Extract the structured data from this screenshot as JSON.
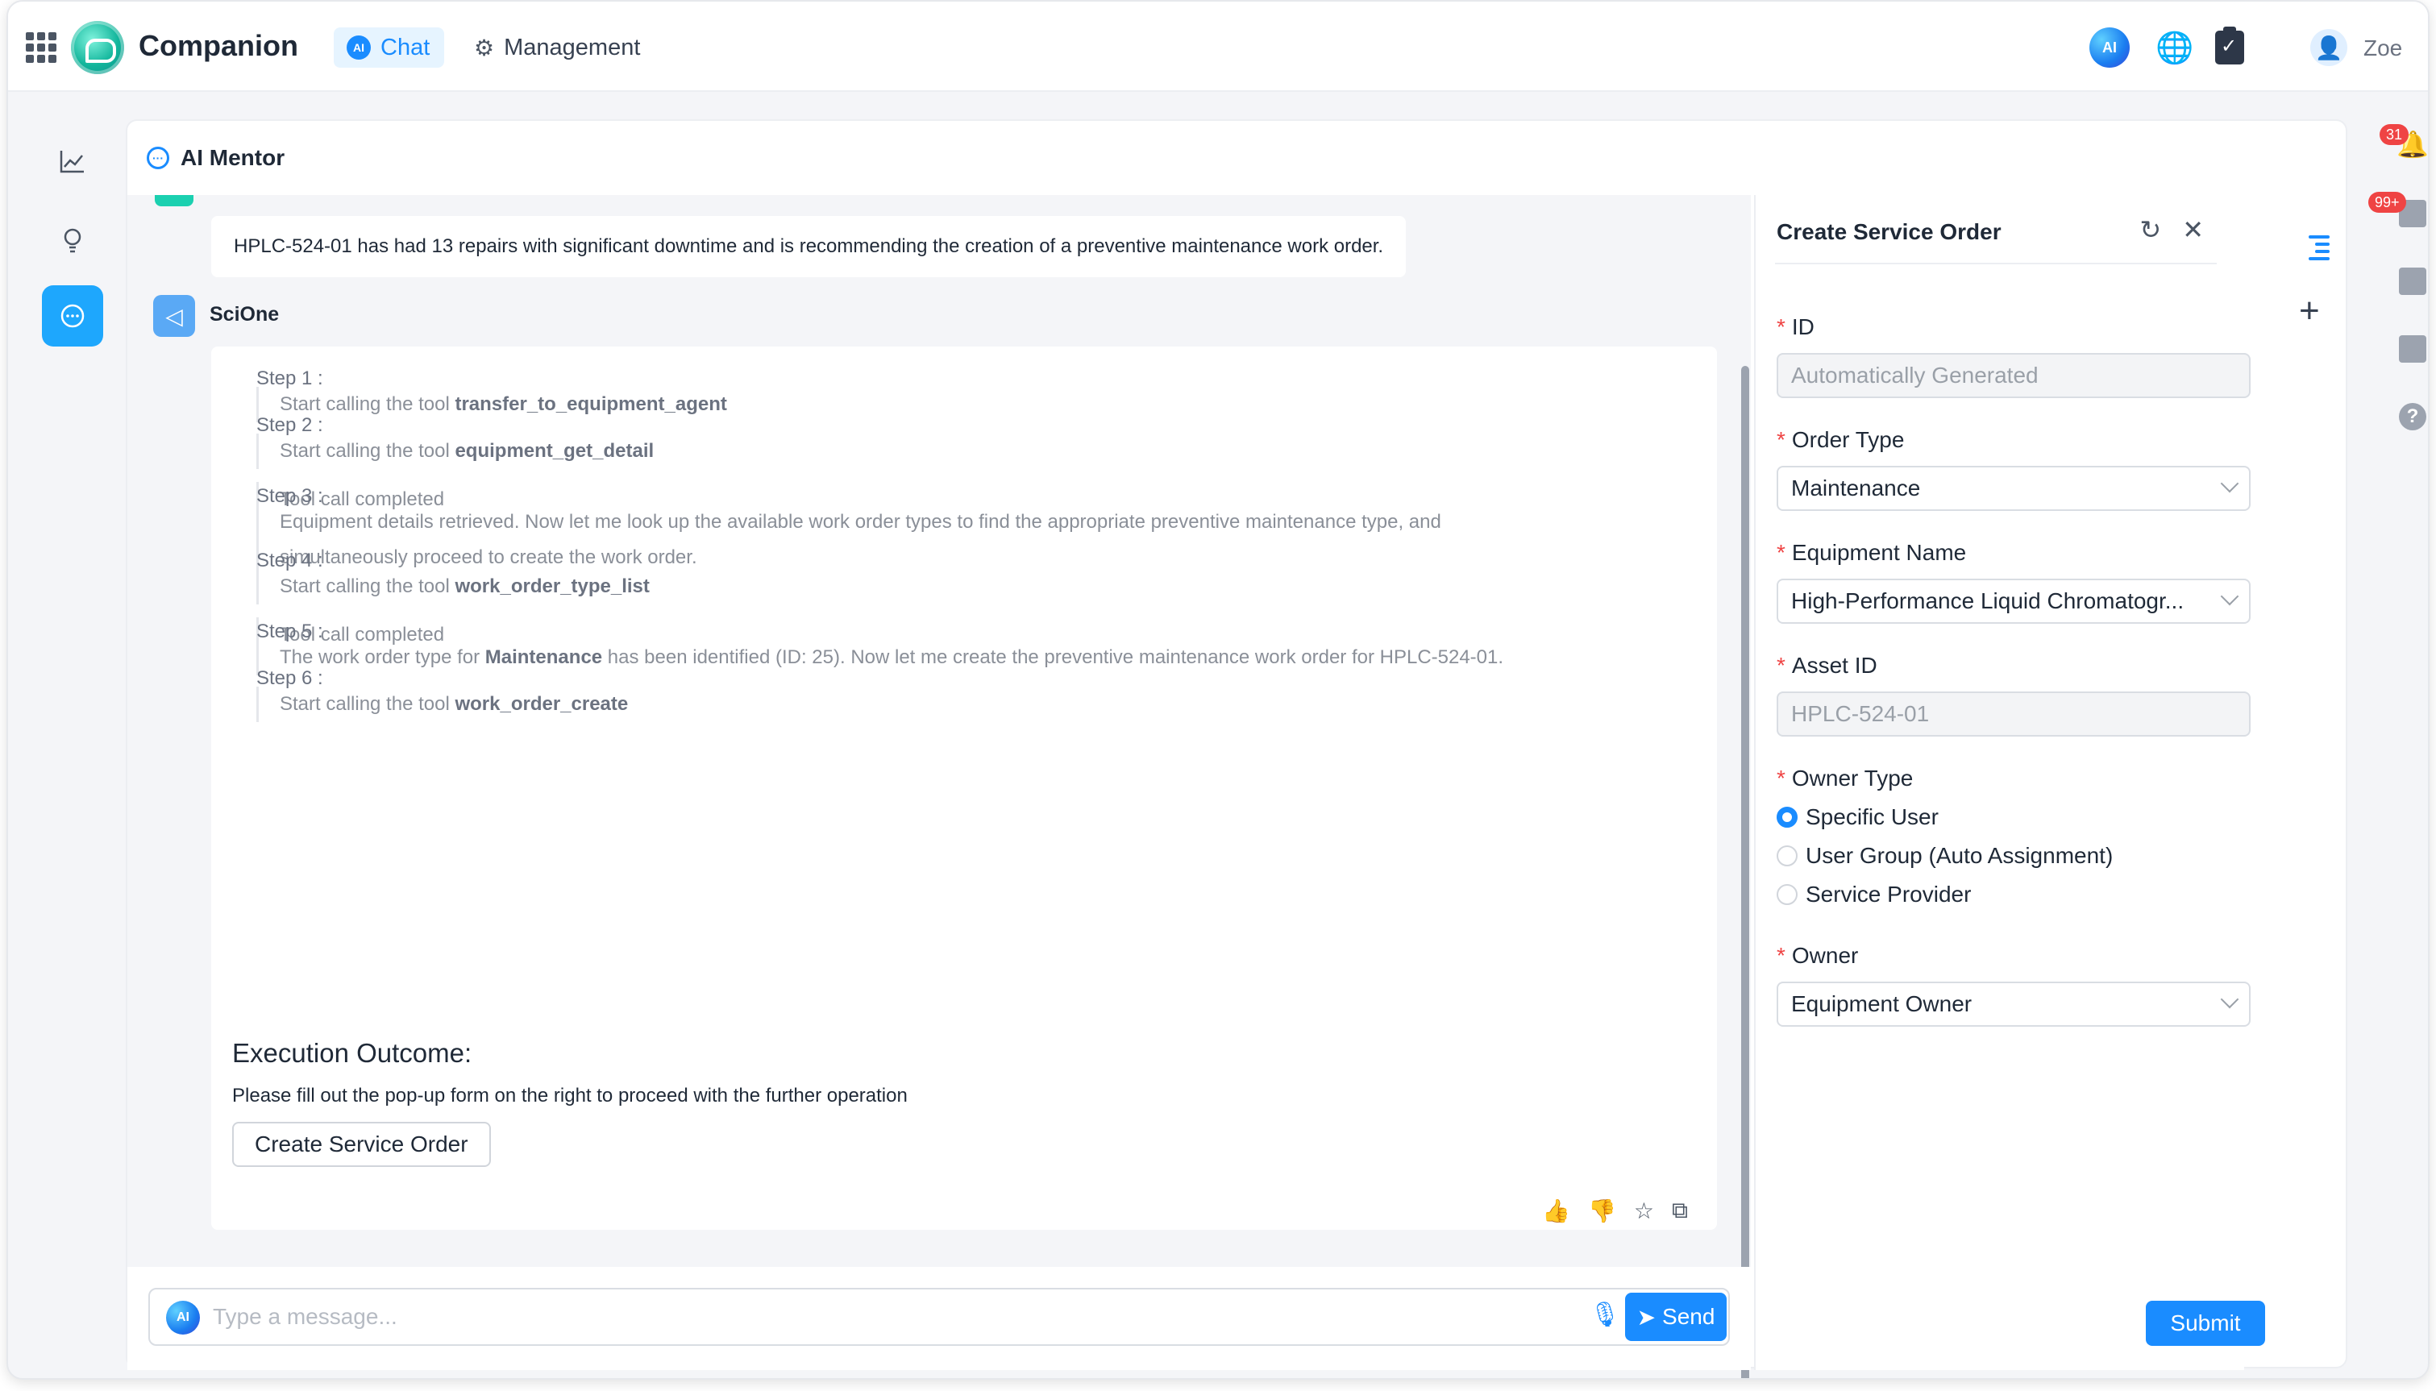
{
  "topbar": {
    "app_name": "Companion",
    "nav": [
      {
        "label": "Chat",
        "badge": "AI"
      },
      {
        "label": "Management"
      }
    ],
    "ai_badge": "AI",
    "user_name": "Zoe"
  },
  "mentor": {
    "title": "AI Mentor"
  },
  "chat": {
    "user_message": "HPLC-524-01 has had 13 repairs with significant downtime and is recommending the creation of a preventive maintenance work order.",
    "assistant_name": "SciOne",
    "steps": [
      {
        "label": "Step 1",
        "lines": [
          {
            "prefix": "Start calling the tool ",
            "bold": "transfer_to_equipment_agent",
            "suffix": ""
          }
        ]
      },
      {
        "label": "Step 2",
        "lines": [
          {
            "prefix": "Start calling the tool ",
            "bold": "equipment_get_detail",
            "suffix": ""
          },
          {
            "prefix": "Tool call completed",
            "bold": "",
            "suffix": ""
          }
        ]
      },
      {
        "label": "Step 3",
        "lines": [
          {
            "prefix": "Equipment details retrieved. Now let me look up the available work order types to find the appropriate preventive maintenance type, and",
            "bold": "",
            "suffix": ""
          },
          {
            "prefix": "simultaneously proceed to create the work order.",
            "bold": "",
            "suffix": ""
          }
        ]
      },
      {
        "label": "Step 4",
        "lines": [
          {
            "prefix": "Start calling the tool ",
            "bold": "work_order_type_list",
            "suffix": ""
          },
          {
            "prefix": "Tool call completed",
            "bold": "",
            "suffix": ""
          }
        ]
      },
      {
        "label": "Step 5",
        "lines": [
          {
            "prefix": "The work order type for ",
            "bold": "Maintenance",
            "suffix": " has been identified (ID: 25). Now let me create the preventive maintenance work order for HPLC-524-01."
          }
        ]
      },
      {
        "label": "Step 6",
        "lines": [
          {
            "prefix": "Start calling the tool ",
            "bold": "work_order_create",
            "suffix": ""
          }
        ]
      }
    ],
    "outcome_title": "Execution Outcome:",
    "outcome_text": "Please fill out the pop-up form on the right to proceed with the further operation",
    "create_button": "Create Service Order",
    "input_placeholder": "Type a message...",
    "input_ai_badge": "AI",
    "send_label": "Send"
  },
  "form": {
    "title": "Create Service Order",
    "id_label": "ID",
    "id_value": "Automatically Generated",
    "order_type_label": "Order Type",
    "order_type_value": "Maintenance",
    "equipment_label": "Equipment Name",
    "equipment_value": "High-Performance Liquid Chromatogr...",
    "asset_label": "Asset ID",
    "asset_value": "HPLC-524-01",
    "owner_type_label": "Owner Type",
    "owner_type_options": [
      "Specific User",
      "User Group (Auto Assignment)",
      "Service Provider"
    ],
    "owner_type_selected": "Specific User",
    "owner_label": "Owner",
    "owner_value": "Equipment Owner",
    "submit_label": "Submit"
  },
  "right_rail": {
    "notification_badge": "31",
    "task_badge": "99+"
  },
  "colors": {
    "accent": "#1a8cff",
    "active_rail": "#1ea7fd",
    "required": "#ef4444",
    "badge": "#ef4444"
  }
}
